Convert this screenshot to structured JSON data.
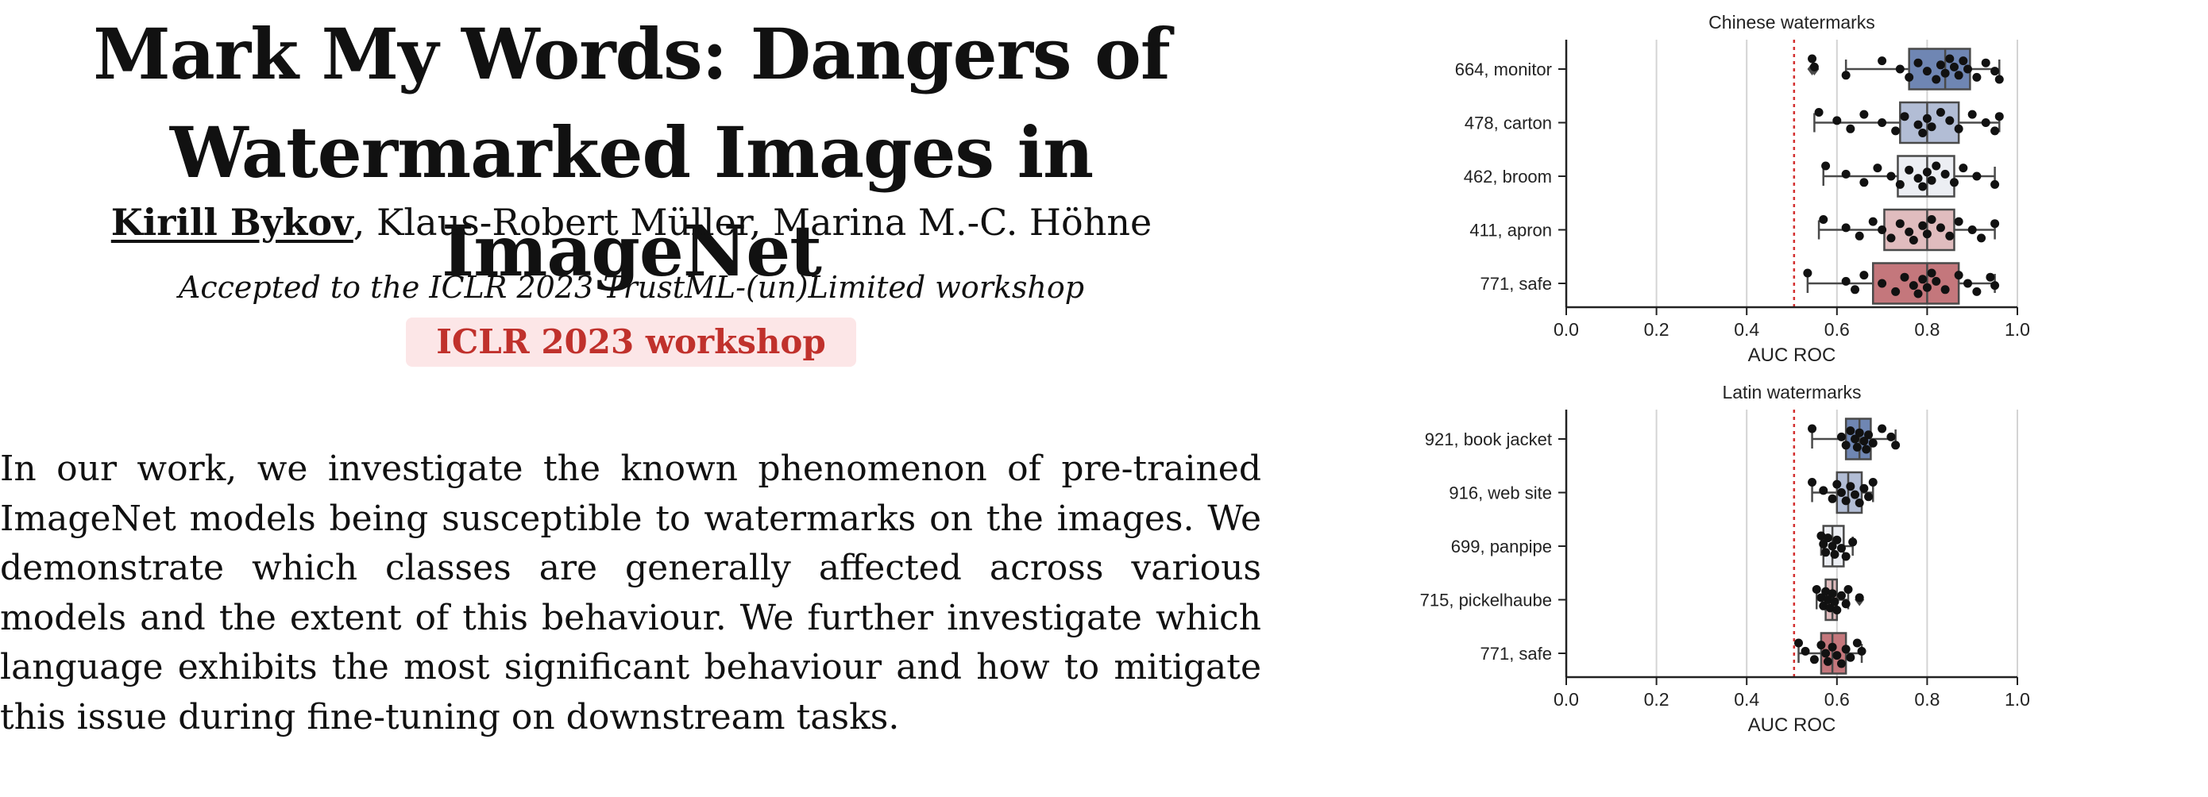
{
  "paper": {
    "title_line1": "Mark My Words: Dangers of",
    "title_line2": "Watermarked Images in ImageNet",
    "first_author": "Kirill Bykov",
    "other_authors": ", Klaus-Robert Müller, Marina M.-C. Höhne",
    "accepted": "Accepted to the ICLR 2023 TrustML-(un)Limited workshop",
    "badge": "ICLR 2023 workshop",
    "abstract_lines": [
      "In our work, we investigate the known phenomenon of pre-trained",
      "ImageNet models being susceptible to watermarks on the images. We",
      "demonstrate which classes are generally affected across various",
      "models and the extent of this behaviour. We further investigate which",
      "language exhibits the most significant behaviour and how to mitigate"
    ],
    "abstract_last": "this issue during fine-tuning on downstream tasks."
  },
  "chart_data": [
    {
      "type": "box",
      "title": "Chinese watermarks",
      "xlabel": "AUC ROC",
      "xlim": [
        0.0,
        1.0
      ],
      "xticks": [
        0.0,
        0.2,
        0.4,
        0.6,
        0.8,
        1.0
      ],
      "xtick_labels": [
        "0.0",
        "0.2",
        "0.4",
        "0.6",
        "0.8",
        "1.0"
      ],
      "grid": "vertical",
      "reference_line": 0.505,
      "categories": [
        "664, monitor",
        "478, carton",
        "462, broom",
        "411, apron",
        "771, safe"
      ],
      "colors": [
        "#6f86b3",
        "#b2bdd5",
        "#eceef3",
        "#e0bcbe",
        "#c4777c"
      ],
      "boxes": [
        {
          "whislo": 0.62,
          "q1": 0.76,
          "med": 0.84,
          "q3": 0.895,
          "whishi": 0.96,
          "fliers": [
            0.545,
            0.55
          ]
        },
        {
          "whislo": 0.55,
          "q1": 0.74,
          "med": 0.8,
          "q3": 0.87,
          "whishi": 0.96,
          "fliers": []
        },
        {
          "whislo": 0.57,
          "q1": 0.735,
          "med": 0.8,
          "q3": 0.86,
          "whishi": 0.95,
          "fliers": []
        },
        {
          "whislo": 0.56,
          "q1": 0.705,
          "med": 0.8,
          "q3": 0.86,
          "whishi": 0.95,
          "fliers": []
        },
        {
          "whislo": 0.535,
          "q1": 0.68,
          "med": 0.8,
          "q3": 0.87,
          "whishi": 0.95,
          "fliers": []
        }
      ],
      "points": [
        [
          0.545,
          0.55,
          0.62,
          0.7,
          0.74,
          0.76,
          0.78,
          0.8,
          0.82,
          0.83,
          0.84,
          0.85,
          0.86,
          0.87,
          0.88,
          0.89,
          0.91,
          0.93,
          0.95,
          0.96
        ],
        [
          0.56,
          0.6,
          0.63,
          0.66,
          0.7,
          0.73,
          0.75,
          0.78,
          0.79,
          0.8,
          0.81,
          0.83,
          0.85,
          0.87,
          0.9,
          0.93,
          0.95,
          0.96
        ],
        [
          0.575,
          0.62,
          0.66,
          0.69,
          0.72,
          0.74,
          0.76,
          0.78,
          0.79,
          0.8,
          0.81,
          0.82,
          0.84,
          0.86,
          0.88,
          0.91,
          0.95
        ],
        [
          0.57,
          0.62,
          0.65,
          0.68,
          0.7,
          0.72,
          0.74,
          0.76,
          0.77,
          0.79,
          0.8,
          0.81,
          0.83,
          0.85,
          0.87,
          0.9,
          0.92,
          0.95
        ],
        [
          0.535,
          0.62,
          0.64,
          0.66,
          0.7,
          0.73,
          0.75,
          0.77,
          0.78,
          0.79,
          0.8,
          0.81,
          0.82,
          0.84,
          0.87,
          0.89,
          0.91,
          0.94,
          0.95
        ]
      ]
    },
    {
      "type": "box",
      "title": "Latin watermarks",
      "xlabel": "AUC ROC",
      "xlim": [
        0.0,
        1.0
      ],
      "xticks": [
        0.0,
        0.2,
        0.4,
        0.6,
        0.8,
        1.0
      ],
      "xtick_labels": [
        "0.0",
        "0.2",
        "0.4",
        "0.6",
        "0.8",
        "1.0"
      ],
      "grid": "vertical",
      "reference_line": 0.505,
      "categories": [
        "921, book jacket",
        "916, web site",
        "699, panpipe",
        "715, pickelhaube",
        "771, safe"
      ],
      "colors": [
        "#6f86b3",
        "#b2bdd5",
        "#eceef3",
        "#e0bcbe",
        "#c4777c"
      ],
      "boxes": [
        {
          "whislo": 0.545,
          "q1": 0.62,
          "med": 0.65,
          "q3": 0.675,
          "whishi": 0.73,
          "fliers": []
        },
        {
          "whislo": 0.545,
          "q1": 0.6,
          "med": 0.625,
          "q3": 0.655,
          "whishi": 0.68,
          "fliers": []
        },
        {
          "whislo": 0.565,
          "q1": 0.57,
          "med": 0.59,
          "q3": 0.615,
          "whishi": 0.635,
          "fliers": []
        },
        {
          "whislo": 0.555,
          "q1": 0.575,
          "med": 0.59,
          "q3": 0.6,
          "whishi": 0.625,
          "fliers": [
            0.65
          ]
        },
        {
          "whislo": 0.515,
          "q1": 0.565,
          "med": 0.59,
          "q3": 0.62,
          "whishi": 0.655,
          "fliers": []
        }
      ],
      "points": [
        [
          0.545,
          0.61,
          0.62,
          0.63,
          0.64,
          0.645,
          0.65,
          0.66,
          0.665,
          0.67,
          0.68,
          0.7,
          0.72,
          0.73
        ],
        [
          0.545,
          0.57,
          0.59,
          0.6,
          0.61,
          0.62,
          0.63,
          0.64,
          0.65,
          0.66,
          0.67,
          0.68
        ],
        [
          0.565,
          0.57,
          0.575,
          0.58,
          0.59,
          0.595,
          0.6,
          0.61,
          0.62,
          0.635
        ],
        [
          0.555,
          0.565,
          0.57,
          0.575,
          0.58,
          0.585,
          0.59,
          0.595,
          0.6,
          0.61,
          0.62,
          0.625,
          0.65
        ],
        [
          0.515,
          0.53,
          0.55,
          0.565,
          0.575,
          0.58,
          0.59,
          0.6,
          0.61,
          0.62,
          0.63,
          0.645,
          0.655
        ]
      ]
    }
  ]
}
